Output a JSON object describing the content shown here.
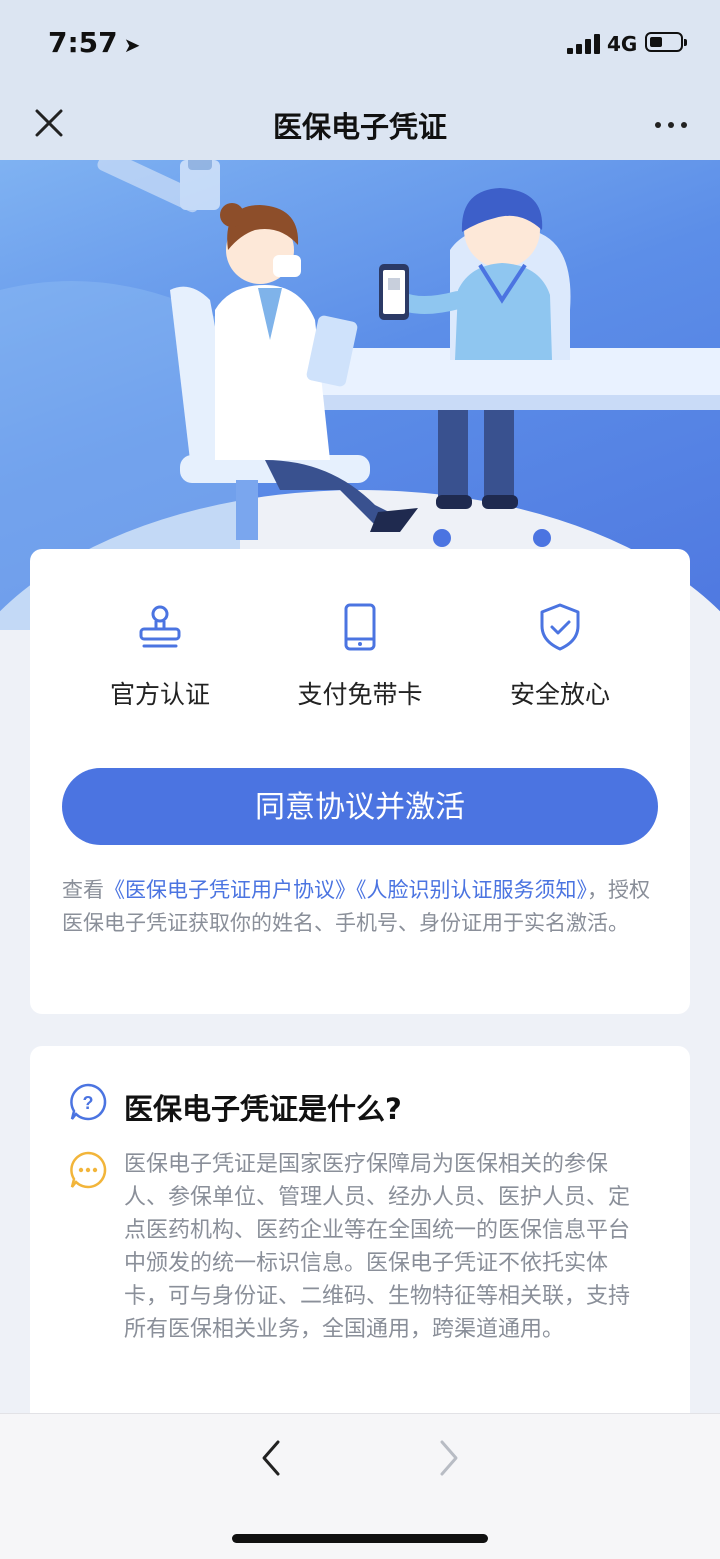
{
  "status_bar": {
    "time": "7:57",
    "network": "4G"
  },
  "nav": {
    "title": "医保电子凭证"
  },
  "features": [
    {
      "icon": "stamp-icon",
      "label": "官方认证"
    },
    {
      "icon": "phone-card-icon",
      "label": "支付免带卡"
    },
    {
      "icon": "shield-check-icon",
      "label": "安全放心"
    }
  ],
  "cta": {
    "label": "同意协议并激活"
  },
  "agreement": {
    "prefix": "查看",
    "link1": "《医保电子凭证用户协议》",
    "link2": "《人脸识别认证服务须知》",
    "suffix": "，授权医保电子凭证获取你的姓名、手机号、身份证用于实名激活。"
  },
  "faq": {
    "question": "医保电子凭证是什么?",
    "answer": "医保电子凭证是国家医疗保障局为医保相关的参保人、参保单位、管理人员、经办人员、医护人员、定点医药机构、医药企业等在全国统一的医保信息平台中颁发的统一标识信息。医保电子凭证不依托实体卡，可与身份证、二维码、生物特征等相关联，支持所有医保相关业务，全国通用，跨渠道通用。"
  },
  "colors": {
    "accent": "#4b74e1",
    "hero_top": "#7fb2f2",
    "hero_bottom": "#4f78e0",
    "answer_icon": "#f2b53a"
  }
}
